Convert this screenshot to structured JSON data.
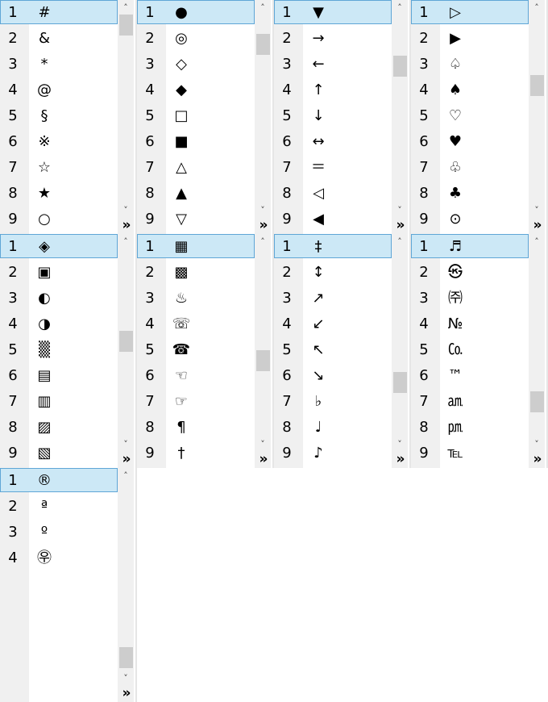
{
  "panels": [
    {
      "symbols": [
        "#",
        "&",
        "*",
        "@",
        "§",
        "※",
        "☆",
        "★",
        "○"
      ],
      "thumb_fraction": 0.0
    },
    {
      "symbols": [
        "●",
        "◎",
        "◇",
        "◆",
        "□",
        "■",
        "△",
        "▲",
        "▽"
      ],
      "thumb_fraction": 0.12
    },
    {
      "symbols": [
        "▼",
        "→",
        "←",
        "↑",
        "↓",
        "↔",
        "＝",
        "◁",
        "◀"
      ],
      "thumb_fraction": 0.25
    },
    {
      "symbols": [
        "▷",
        "▶",
        "♤",
        "♠",
        "♡",
        "♥",
        "♧",
        "♣",
        "⊙"
      ],
      "thumb_fraction": 0.37
    },
    {
      "symbols": [
        "◈",
        "▣",
        "◐",
        "◑",
        "▒",
        "▤",
        "▥",
        "▨",
        "▧"
      ],
      "thumb_fraction": 0.5
    },
    {
      "symbols": [
        "▦",
        "▩",
        "♨",
        "☏",
        "☎",
        "☜",
        "☞",
        "¶",
        "†"
      ],
      "thumb_fraction": 0.62
    },
    {
      "symbols": [
        "‡",
        "↕",
        "↗",
        "↙",
        "↖",
        "↘",
        "♭",
        "♩",
        "♪"
      ],
      "thumb_fraction": 0.75
    },
    {
      "symbols": [
        "♬",
        "㉿",
        "㈜",
        "№",
        "㏇",
        "™",
        "㏂",
        "㏘",
        "℡"
      ],
      "thumb_fraction": 0.87
    },
    {
      "symbols": [
        "®",
        "ª",
        "º",
        "㉾"
      ],
      "thumb_fraction": 1.0
    }
  ],
  "row_numbers": [
    "1",
    "2",
    "3",
    "4",
    "5",
    "6",
    "7",
    "8",
    "9"
  ],
  "scroll_up_glyph": "˄",
  "scroll_down_glyph": "˅",
  "more_glyph": "»",
  "colors": {
    "selection_bg": "#cce8f6",
    "selection_border": "#5fa6d6",
    "number_column_bg": "#f0f0f0"
  }
}
